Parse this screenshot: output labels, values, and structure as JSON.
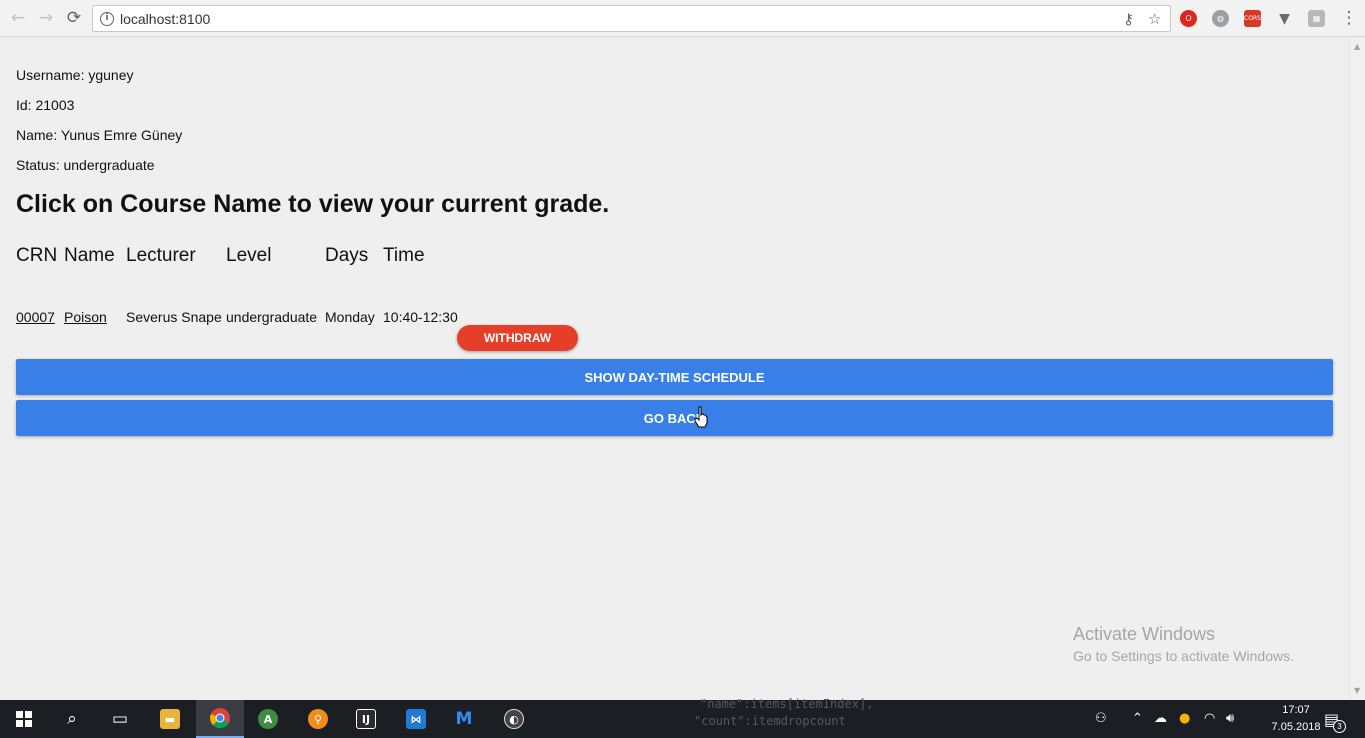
{
  "browser": {
    "url": "localhost:8100",
    "back_icon": "arrow-left-icon",
    "forward_icon": "arrow-right-icon",
    "reload_icon": "reload-icon",
    "key_icon": "key-icon",
    "star_icon": "star-icon",
    "ext_cors_label": "CORS"
  },
  "user": {
    "username_line": "Username: yguney",
    "id_line": "Id: 21003",
    "name_line": "Name: Yunus Emre Güney",
    "status_line": "Status: undergraduate"
  },
  "headline": "Click on Course Name to view your current grade.",
  "table": {
    "headers": [
      "CRN",
      "Name",
      "Lecturer",
      "Level",
      "Days",
      "Time"
    ],
    "rows": [
      [
        "00007",
        "Poison",
        "Severus Snape",
        "undergraduate",
        "Monday",
        "10:40-12:30"
      ]
    ]
  },
  "buttons": {
    "withdraw": "WITHDRAW",
    "schedule": "SHOW DAY-TIME SCHEDULE",
    "go_back": "GO BACK"
  },
  "watermark": {
    "title": "Activate Windows",
    "subtitle": "Go to Settings to activate Windows."
  },
  "taskbar": {
    "background_code_1": "\"name\":items[itemIndex],",
    "background_code_2": "\"count\":itemdropcount",
    "clock_time": "17:07",
    "clock_date": "7.05.2018",
    "notification_count": "3"
  },
  "colors": {
    "primary": "#3880e7",
    "danger": "#e53f2a",
    "page_bg": "#efefef"
  }
}
